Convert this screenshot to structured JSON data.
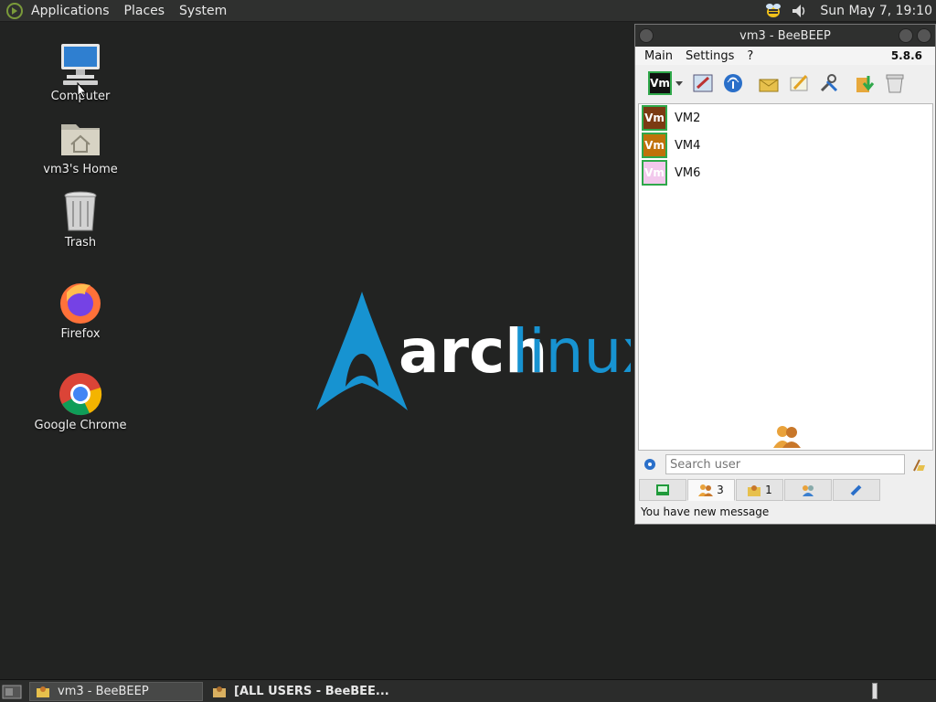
{
  "top_panel": {
    "menus": [
      "Applications",
      "Places",
      "System"
    ],
    "clock": "Sun May  7, 19:10"
  },
  "desktop": {
    "icons": [
      {
        "label": "Computer",
        "icon": "computer-icon"
      },
      {
        "label": "vm3's Home",
        "icon": "home-folder-icon"
      },
      {
        "label": "Trash",
        "icon": "trash-icon"
      },
      {
        "label": "Firefox",
        "icon": "firefox-icon"
      },
      {
        "label": "Google Chrome",
        "icon": "chrome-icon"
      }
    ],
    "wallpaper": {
      "logo_word1": "arch",
      "logo_word2": "linux",
      "accent": "#1793d1"
    }
  },
  "beebeep": {
    "title": "vm3 - BeeBEEP",
    "menu": [
      "Main",
      "Settings",
      "?"
    ],
    "version": "5.8.6",
    "toolbar": {
      "profile_badge": "Vm",
      "icons": [
        "edit-profile-icon",
        "network-icon",
        "message-icon",
        "write-icon",
        "tools-icon",
        "download-icon",
        "trash-icon"
      ]
    },
    "users": [
      {
        "name": "VM2",
        "badge": "Vm",
        "badge_color": "#7b3a12",
        "text_color": "#ffffff"
      },
      {
        "name": "VM4",
        "badge": "Vm",
        "badge_color": "#c0720a",
        "text_color": "#ffffff"
      },
      {
        "name": "VM6",
        "badge": "Vm",
        "badge_color": "#f2c8ec",
        "text_color": "#ffffff"
      }
    ],
    "search_placeholder": "Search user",
    "tabs": [
      {
        "label": "",
        "icon": "chat-list-icon"
      },
      {
        "label": "3",
        "icon": "users-icon",
        "active": true
      },
      {
        "label": "1",
        "icon": "groups-icon"
      },
      {
        "label": "",
        "icon": "network-users-icon"
      },
      {
        "label": "",
        "icon": "plugins-icon"
      }
    ],
    "status": "You have new message"
  },
  "taskbar": {
    "tasks": [
      {
        "label": "vm3 - BeeBEEP",
        "active": true
      },
      {
        "label": "[ALL USERS - BeeBEE...",
        "active": false,
        "bold": true
      }
    ]
  }
}
